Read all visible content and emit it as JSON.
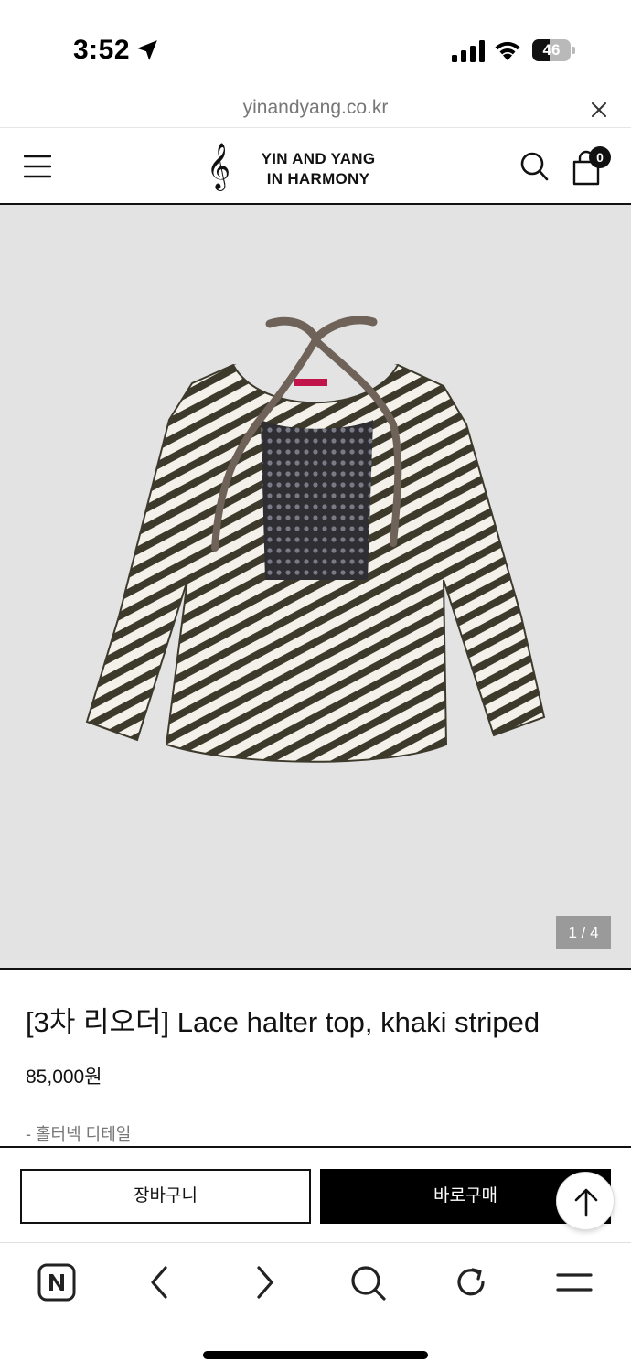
{
  "status_bar": {
    "time": "3:52",
    "battery_level": "46",
    "battery_fraction": 0.46,
    "icons": [
      "location-arrow-icon",
      "cellular-signal-icon",
      "wifi-icon",
      "battery-icon"
    ]
  },
  "browser": {
    "url": "yinandyang.co.kr",
    "close_icon": "close-icon"
  },
  "site_header": {
    "logo_mark": "𝄞",
    "logo_line1": "YIN AND YANG",
    "logo_line2": "IN HARMONY",
    "cart_count": "0",
    "icons": [
      "menu-icon",
      "treble-clef-logo",
      "search-icon",
      "shopping-bag-icon"
    ]
  },
  "product": {
    "image_counter": "1 / 4",
    "title": "[3차 리오더] Lace halter top, khaki striped",
    "price": "85,000원",
    "detail": "- 홀터넥 디테일"
  },
  "purchase_bar": {
    "cart_label": "장바구니",
    "buy_label": "바로구매",
    "scroll_top_icon": "arrow-up-icon"
  },
  "browser_toolbar": {
    "icons": [
      "naver-home-icon",
      "back-chevron-icon",
      "forward-chevron-icon",
      "search-icon",
      "reload-icon",
      "menu-icon"
    ]
  },
  "colors": {
    "stripe_dark": "#3d3a2c",
    "stripe_light": "#f3f1ea",
    "lace": "#6e6259",
    "image_bg": "#e3e3e3",
    "accent_black": "#000000"
  }
}
